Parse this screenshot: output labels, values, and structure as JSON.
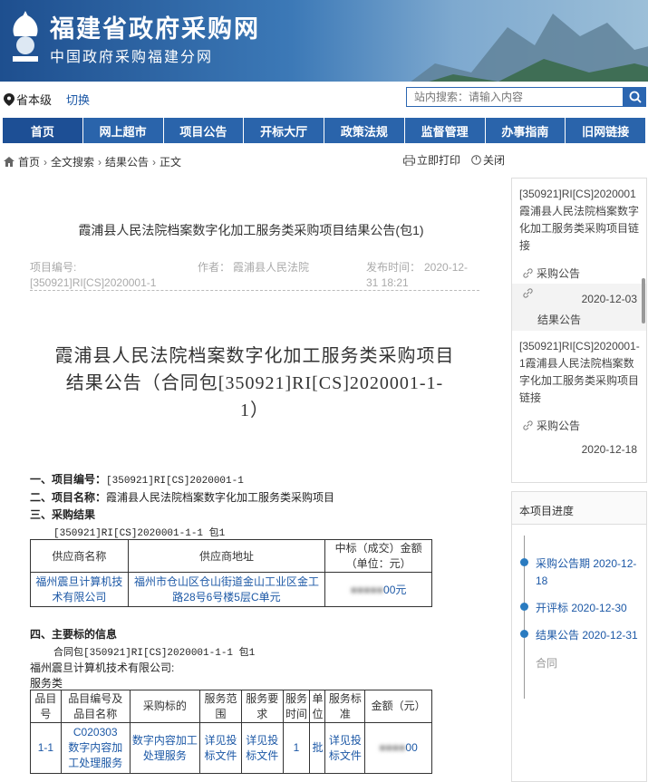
{
  "site": {
    "title": "福建省政府采购网",
    "subtitle": "中国政府采购福建分网"
  },
  "location": {
    "level": "省本级",
    "switch": "切换"
  },
  "search": {
    "placeholder": "站内搜索：请输入内容"
  },
  "nav": [
    "首页",
    "网上超市",
    "项目公告",
    "开标大厅",
    "政策法规",
    "监督管理",
    "办事指南",
    "旧网链接"
  ],
  "breadcrumb": [
    "首页",
    "全文搜索",
    "结果公告",
    "正文"
  ],
  "tools": {
    "print": "立即打印",
    "close": "关闭"
  },
  "article": {
    "title": "霞浦县人民法院档案数字化加工服务类采购项目结果公告(包1)",
    "id_label": "项目编号:",
    "id_value": "[350921]RI[CS]2020001-1",
    "author_label": "作者：",
    "author": "霞浦县人民法院",
    "time_label": "发布时间：",
    "time_l1": "2020-12-",
    "time_l2": "31 18:21",
    "big_title_l1": "霞浦县人民法院档案数字化加工服务类采购项目",
    "big_title_l2": "结果公告（合同包[350921]RI[CS]2020001-1-",
    "big_title_l3": "1）",
    "s1_label": "一、项目编号：",
    "s1_value": "[350921]RI[CS]2020001-1",
    "s2_label": "二、项目名称：",
    "s2_value": "霞浦县人民法院档案数字化加工服务类采购项目",
    "s3_label": "三、采购结果",
    "s3_pkg": "[350921]RI[CS]2020001-1-1 包1",
    "t1_headers": [
      "供应商名称",
      "供应商地址",
      "中标（成交）金额",
      "（单位：元）"
    ],
    "t1_row": {
      "name": "福州震旦计算机技术有限公司",
      "addr": "福州市仓山区仓山街道金山工业区金工路28号6号楼5层C单元",
      "amount": "00元"
    },
    "s4_label": "四、主要标的信息",
    "s4_pkg": "合同包[350921]RI[CS]2020001-1-1 包1",
    "s4_company": "福州震旦计算机技术有限公司:",
    "s4_type": "服务类",
    "t2_headers": [
      "品目号",
      "品目编号及品目名称",
      "采购标的",
      "服务范围",
      "服务要求",
      "服务时间",
      "单位",
      "服务标准",
      "金额（元）"
    ],
    "t2_row": {
      "no": "1-1",
      "code": "C020303",
      "cat": "数字内容加工处理服务",
      "target": "数字内容加工处理服务",
      "scope": "详见投标文件",
      "req": "详见投标文件",
      "time": "1",
      "unit": "批",
      "std": "详见投标文件",
      "amount": "00"
    }
  },
  "sidebar": {
    "link1": "[350921]RI[CS]2020001霞浦县人民法院档案数字化加工服务类采购项目链接",
    "item1": "采购公告",
    "date1": "2020-12-03",
    "item2": "结果公告",
    "link2": "[350921]RI[CS]2020001-1霞浦县人民法院档案数字化加工服务类采购项目链接",
    "item3": "采购公告",
    "date3": "2020-12-18"
  },
  "progress": {
    "title": "本项目进度",
    "steps": [
      "采购公告期 2020-12-18",
      "开评标 2020-12-30",
      "结果公告 2020-12-31",
      "合同"
    ]
  },
  "colors": {
    "nav": "#2a64ab",
    "link": "#1c58a6"
  }
}
